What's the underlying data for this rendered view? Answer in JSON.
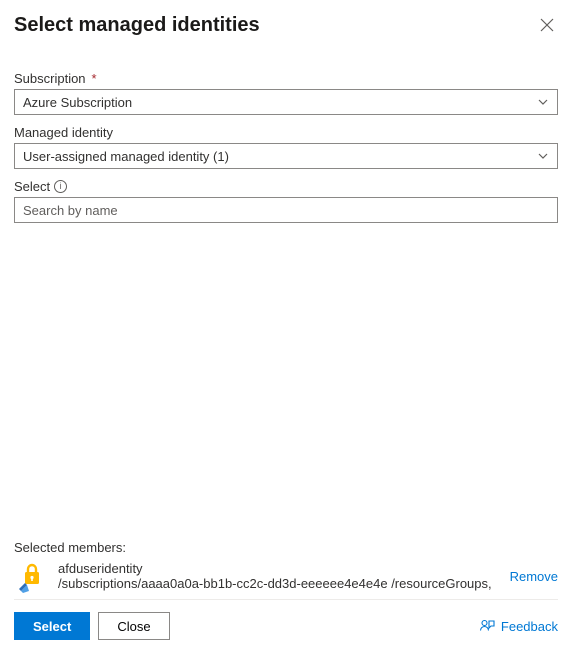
{
  "header": {
    "title": "Select managed identities"
  },
  "form": {
    "subscription": {
      "label": "Subscription",
      "required": true,
      "value": "Azure Subscription"
    },
    "managedIdentity": {
      "label": "Managed identity",
      "value": "User-assigned managed identity (1)"
    },
    "select": {
      "label": "Select",
      "placeholder": "Search by name"
    }
  },
  "selected": {
    "heading": "Selected members:",
    "members": [
      {
        "name": "afduseridentity",
        "subtitle": "/subscriptions/aaaa0a0a-bb1b-cc2c-dd3d-eeeeee4e4e4e /resourceGroups,",
        "removeLabel": "Remove"
      }
    ]
  },
  "footer": {
    "primary": "Select",
    "secondary": "Close",
    "feedback": "Feedback"
  }
}
